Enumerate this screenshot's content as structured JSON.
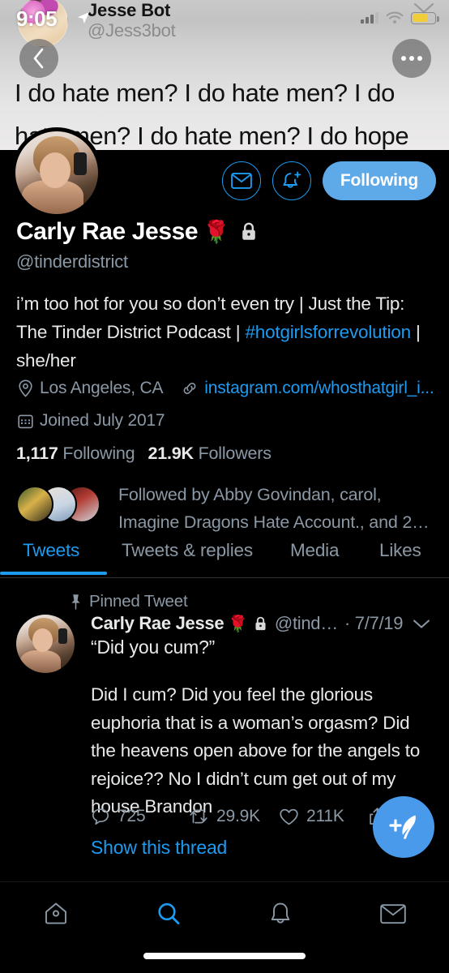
{
  "status_bar": {
    "time": "9:05",
    "location_icon": "location-arrow-icon",
    "signal_icon": "cellular-signal-icon",
    "wifi_icon": "wifi-icon",
    "battery_icon": "battery-low-power-icon",
    "battery_color": "#f2cd3a"
  },
  "banner": {
    "author_name": "Jesse Bot",
    "author_handle": "@Jess3bot",
    "tweet_text": "I do hate men? I do hate men? I do hate men? I do hate men? I do hope",
    "back_icon": "back-chevron-icon",
    "more_icon": "more-options-icon",
    "chevron_icon": "chevron-down-icon"
  },
  "profile": {
    "avatar_name": "profile-avatar",
    "display_name": "Carly Rae Jesse",
    "name_emoji": "🌹",
    "protected_icon": "lock-icon",
    "handle": "@tinderdistrict",
    "bio_part1": "i’m too hot for you so don’t even try | Just the Tip: The Tinder District Podcast | ",
    "bio_hashtag": "#hotgirlsforrevolution",
    "bio_part2": " | she/her",
    "location": "Los Angeles, CA",
    "location_icon": "location-pin-icon",
    "website": "instagram.com/whosthatgirl_i...",
    "website_icon": "link-icon",
    "joined": "Joined July 2017",
    "joined_icon": "calendar-icon",
    "following_count": "1,117",
    "following_label": "Following",
    "followers_count": "21.9K",
    "followers_label": "Followers",
    "followed_by": "Followed by Abby Govindan, carol, Imagine Dragons Hate Account., and 2…",
    "message_icon": "envelope-icon",
    "notify_icon": "bell-add-icon",
    "follow_button": "Following",
    "accent_color": "#1d9bf0",
    "follow_button_color": "#5ea9e8"
  },
  "tabs": [
    {
      "label": "Tweets",
      "active": true
    },
    {
      "label": "Tweets & replies",
      "active": false
    },
    {
      "label": "Media",
      "active": false
    },
    {
      "label": "Likes",
      "active": false
    }
  ],
  "pinned_tweet": {
    "pinned_label": "Pinned Tweet",
    "pin_icon": "pin-icon",
    "avatar_name": "tweet-author-avatar",
    "author_name": "Carly Rae Jesse",
    "author_emoji": "🌹",
    "protected_icon": "lock-icon",
    "handle": "@tind…",
    "date": "· 7/7/19",
    "caret_icon": "chevron-down-icon",
    "quote_line": "“Did you cum?”",
    "body": "Did I cum? Did you feel the glorious euphoria that is a woman’s orgasm? Did the heavens open above for the angels to rejoice?? No I didn’t cum get out of my house Brandon",
    "reply_count": "725",
    "reply_icon": "reply-icon",
    "retweet_count": "29.9K",
    "retweet_icon": "retweet-icon",
    "like_count": "211K",
    "like_icon": "heart-icon",
    "share_icon": "share-icon",
    "show_thread": "Show this thread"
  },
  "compose_fab": {
    "icon": "compose-feather-plus-icon",
    "color": "#4a9aeb"
  },
  "bottom_nav": [
    {
      "icon": "home-icon",
      "active": false
    },
    {
      "icon": "search-icon",
      "active": true
    },
    {
      "icon": "bell-icon",
      "active": false
    },
    {
      "icon": "envelope-icon",
      "active": false
    }
  ]
}
